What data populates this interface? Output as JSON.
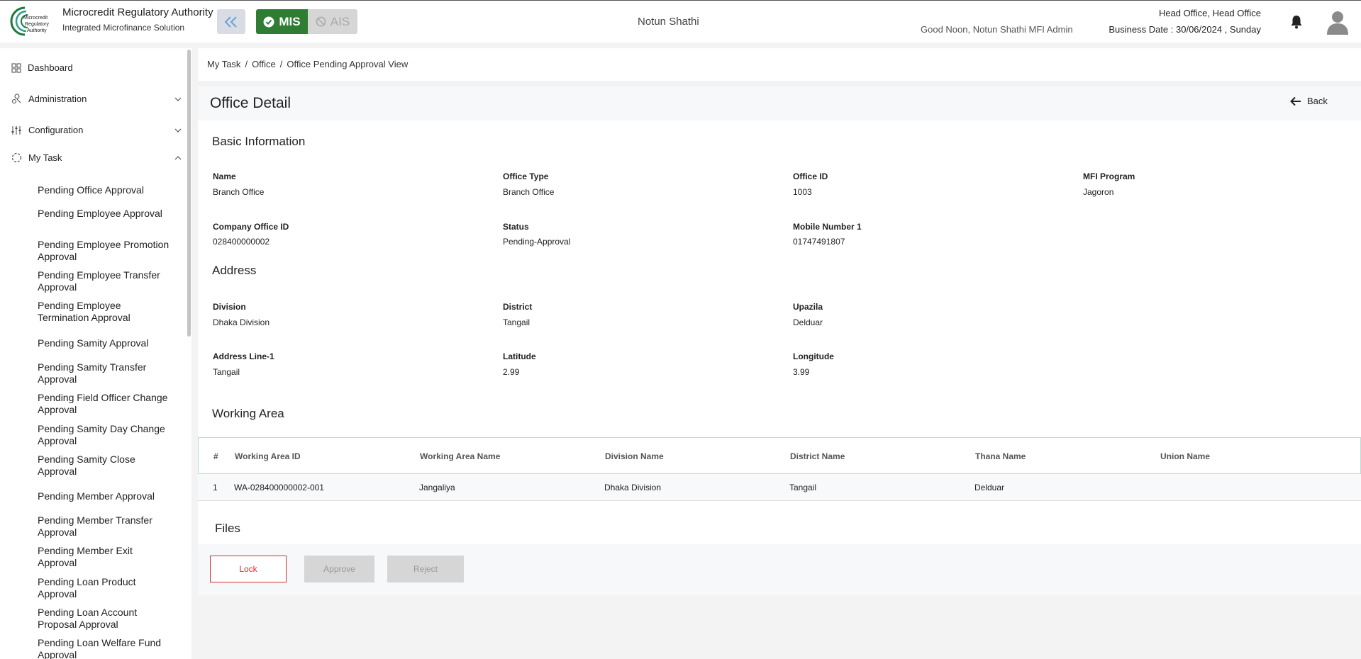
{
  "header": {
    "org_title": "Microcredit Regulatory Authority",
    "org_subtitle": "Integrated Microfinance Solution",
    "logo_text": "Microcredit Regulatory Authority",
    "mis_label": "MIS",
    "ais_label": "AIS",
    "center_title": "Notun Shathi",
    "greeting": "Good Noon, Notun Shathi MFI Admin",
    "office": "Head Office, Head Office",
    "business_date": "Business Date : 30/06/2024 , Sunday",
    "colors": {
      "mis": "#2e7d32",
      "logo": "#1b7a3a"
    }
  },
  "sidebar": {
    "top_items": [
      {
        "label": "Dashboard",
        "icon": "grid-icon"
      },
      {
        "label": "Administration",
        "icon": "users-cog-icon"
      },
      {
        "label": "Configuration",
        "icon": "sliders-icon"
      },
      {
        "label": "My Task",
        "icon": "circle-dashed-icon"
      }
    ],
    "sub_items": [
      "Pending Office Approval",
      "Pending Employee Approval",
      "Pending Employee Promotion Approval",
      "Pending Employee Transfer Approval",
      "Pending Employee Termination Approval",
      "Pending Samity Approval",
      "Pending Samity Transfer Approval",
      "Pending Field Officer Change Approval",
      "Pending Samity Day Change Approval",
      "Pending Samity Close Approval",
      "Pending Member Approval",
      "Pending Member Transfer Approval",
      "Pending Member Exit Approval",
      "Pending Loan Product Approval",
      "Pending Loan Account Proposal Approval",
      "Pending Loan Welfare Fund Approval"
    ]
  },
  "breadcrumb": [
    "My Task",
    "Office",
    "Office Pending Approval View"
  ],
  "page": {
    "title": "Office Detail",
    "back_label": "Back"
  },
  "basic_info": {
    "title": "Basic Information",
    "fields": [
      {
        "label": "Name",
        "value": "Branch Office"
      },
      {
        "label": "Office Type",
        "value": "Branch Office"
      },
      {
        "label": "Office ID",
        "value": "1003"
      },
      {
        "label": "MFI Program",
        "value": "Jagoron"
      },
      {
        "label": "Company Office ID",
        "value": "028400000002"
      },
      {
        "label": "Status",
        "value": "Pending-Approval"
      },
      {
        "label": "Mobile Number 1",
        "value": "01747491807"
      }
    ]
  },
  "address": {
    "title": "Address",
    "fields": [
      {
        "label": "Division",
        "value": "Dhaka Division"
      },
      {
        "label": "District",
        "value": "Tangail"
      },
      {
        "label": "Upazila",
        "value": "Delduar"
      },
      {
        "label": "Address Line-1",
        "value": "Tangail"
      },
      {
        "label": "Latitude",
        "value": "2.99"
      },
      {
        "label": "Longitude",
        "value": "3.99"
      }
    ]
  },
  "working_area": {
    "title": "Working Area",
    "columns": [
      "#",
      "Working Area ID",
      "Working Area Name",
      "Division Name",
      "District Name",
      "Thana Name",
      "Union Name"
    ],
    "rows": [
      [
        "1",
        "WA-028400000002-001",
        "Jangaliya",
        "Dhaka Division",
        "Tangail",
        "Delduar",
        ""
      ]
    ]
  },
  "files": {
    "title": "Files"
  },
  "actions": {
    "lock": "Lock",
    "approve": "Approve",
    "reject": "Reject"
  }
}
